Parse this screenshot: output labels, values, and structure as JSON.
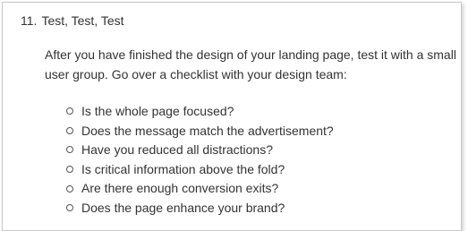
{
  "section": {
    "number": "11.",
    "title": "Test, Test, Test"
  },
  "intro": "After you have finished the design of your landing page, test it with a small user group. Go over a checklist with your design team:",
  "checklist": [
    "Is the whole page focused?",
    "Does the message match the advertisement?",
    "Have you reduced all distractions?",
    "Is critical information above the fold?",
    "Are there enough conversion exits?",
    "Does the page enhance your brand?"
  ]
}
